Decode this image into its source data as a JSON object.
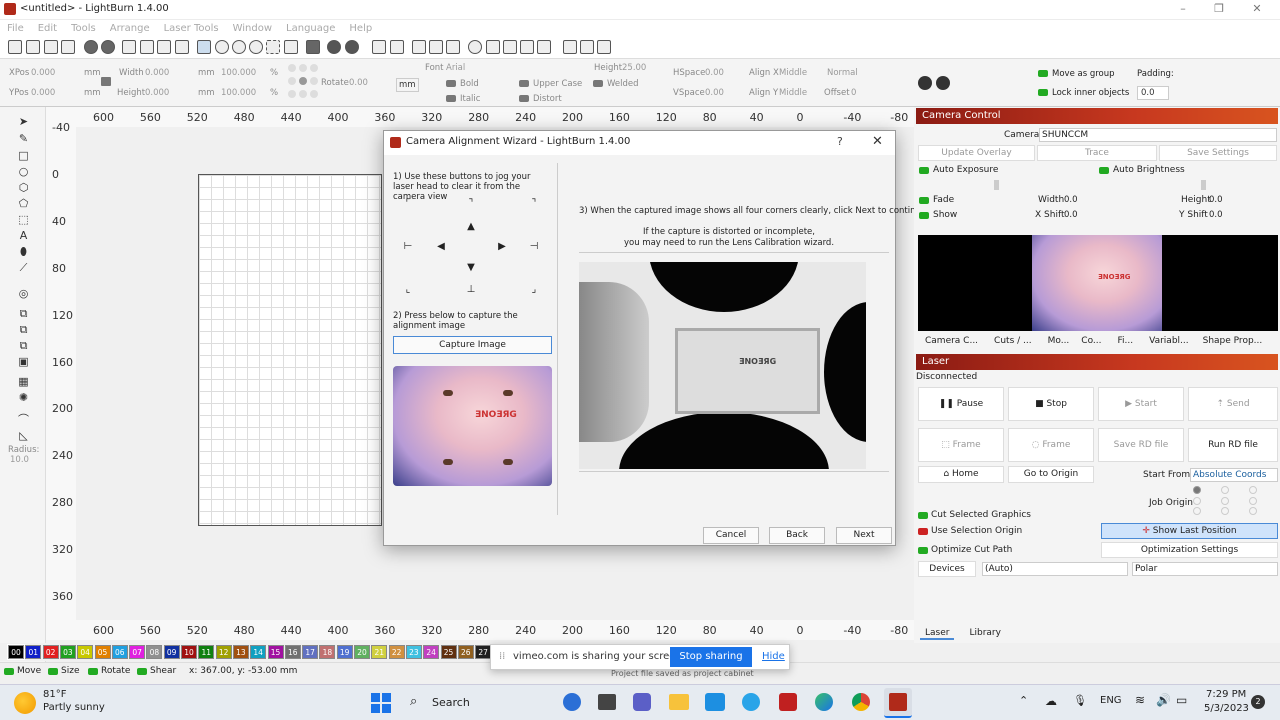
{
  "app": {
    "title": "<untitled> - LightBurn 1.4.00"
  },
  "menu": [
    "File",
    "Edit",
    "Tools",
    "Arrange",
    "Laser Tools",
    "Window",
    "Language",
    "Help"
  ],
  "props": {
    "xpos_label": "XPos",
    "xpos": "0.000",
    "ypos_label": "YPos",
    "ypos": "0.000",
    "unit": "mm",
    "width_label": "Width",
    "width": "0.000",
    "height_label": "Height",
    "height": "0.000",
    "pct_w": "100.000",
    "pct_h": "100.000",
    "pct": "%",
    "rotate_label": "Rotate",
    "rotate": "0.00",
    "rotate_unit": "mm",
    "font_label": "Font",
    "font": "Arial",
    "font_height_label": "Height",
    "font_height": "25.00",
    "bold": "Bold",
    "italic": "Italic",
    "upper_case": "Upper Case",
    "welded": "Welded",
    "distort": "Distort",
    "hspace_label": "HSpace",
    "hspace": "0.00",
    "vspace_label": "VSpace",
    "vspace": "0.00",
    "alignx_label": "Align X",
    "alignx": "Middle",
    "aligny_label": "Align Y",
    "aligny": "Middle",
    "normal": "Normal",
    "offset_label": "Offset",
    "offset": "0",
    "move_as_group": "Move as group",
    "lock_inner": "Lock inner objects",
    "padding_label": "Padding:",
    "padding": "0.0"
  },
  "ruler": {
    "top": [
      "600",
      "560",
      "520",
      "480",
      "440",
      "400",
      "360",
      "320",
      "280",
      "240",
      "200",
      "160",
      "120",
      "80",
      "40",
      "0",
      "-40",
      "-80"
    ],
    "left": [
      "-40",
      "0",
      "40",
      "80",
      "120",
      "160",
      "200",
      "240",
      "280",
      "320",
      "360"
    ]
  },
  "left_radius_label": "Radius:",
  "left_radius": "10.0",
  "palette": [
    "00",
    "01",
    "02",
    "03",
    "04",
    "05",
    "06",
    "07",
    "08",
    "09",
    "10",
    "11",
    "12",
    "13",
    "14",
    "15",
    "16",
    "17",
    "18",
    "19",
    "20",
    "21",
    "22",
    "23",
    "24",
    "25",
    "26",
    "27"
  ],
  "palette_colors": [
    "#000000",
    "#1020c8",
    "#e02020",
    "#20a020",
    "#c8c800",
    "#e08000",
    "#20a0e0",
    "#e020e0",
    "#909090",
    "#1030a0",
    "#a01010",
    "#108010",
    "#a0a000",
    "#a05010",
    "#10a0c0",
    "#a010a0",
    "#707070",
    "#6070c0",
    "#c07070",
    "#5070d0",
    "#60b060",
    "#d0d040",
    "#d09040",
    "#40c0e0",
    "#c040c0",
    "#603010",
    "#906020",
    "#202020"
  ],
  "status": {
    "move": "Move",
    "size": "Size",
    "rotate": "Rotate",
    "shear": "Shear",
    "coords": "x: 367.00, y: -53.00 mm",
    "saved": "Project file saved as project cabinet"
  },
  "dialog": {
    "title": "Camera Alignment Wizard - LightBurn 1.4.00",
    "help": "?",
    "step1": "1) Use these buttons to jog your laser head to clear it from the camera view",
    "step2": "2) Press below to capture the alignment image",
    "capture": "Capture Image",
    "step3": "3) When the captured image shows all four corners clearly, click Next to continue",
    "note1": "If the capture is distorted or incomplete,",
    "note2": "you may need to run the Lens Calibration wizard.",
    "cancel": "Cancel",
    "back": "Back",
    "next": "Next",
    "target_text": "ƎNOƎЯG"
  },
  "camera": {
    "header": "Camera Control",
    "camera_label": "Camera:",
    "camera": "SHUNCCM",
    "update_overlay": "Update Overlay",
    "trace": "Trace",
    "save_settings": "Save Settings",
    "auto_exposure": "Auto Exposure",
    "auto_brightness": "Auto Brightness",
    "fade": "Fade",
    "show": "Show",
    "width_label": "Width",
    "width": "0.0",
    "height_label": "Height",
    "height": "0.0",
    "xshift_label": "X Shift",
    "xshift": "0.0",
    "yshift_label": "Y Shift",
    "yshift": "0.0",
    "tabs": [
      "Camera C...",
      "Cuts / ...",
      "Mo...",
      "Co...",
      "Fi...",
      "Variabl...",
      "Shape Prop..."
    ]
  },
  "laser": {
    "header": "Laser",
    "status": "Disconnected",
    "pause": "Pause",
    "stop": "Stop",
    "start": "Start",
    "send": "Send",
    "frame1": "Frame",
    "frame2": "Frame",
    "save_rd": "Save RD file",
    "run_rd": "Run RD file",
    "home": "Home",
    "go_origin": "Go to Origin",
    "start_from_label": "Start From:",
    "start_from": "Absolute Coords",
    "job_origin": "Job Origin",
    "cut_selected": "Cut Selected Graphics",
    "use_selection": "Use Selection Origin",
    "show_last": "Show Last Position",
    "optimize": "Optimize Cut Path",
    "opt_settings": "Optimization Settings",
    "devices": "Devices",
    "device": "(Auto)",
    "polar": "Polar",
    "bottom_tabs": [
      "Laser",
      "Library"
    ]
  },
  "share": {
    "text": "vimeo.com is sharing your screen.",
    "stop": "Stop sharing",
    "hide": "Hide"
  },
  "taskbar": {
    "temp": "81°F",
    "weather": "Partly sunny",
    "search": "Search",
    "lang": "ENG",
    "time": "7:29 PM",
    "date": "5/3/2023",
    "badge": "2"
  }
}
